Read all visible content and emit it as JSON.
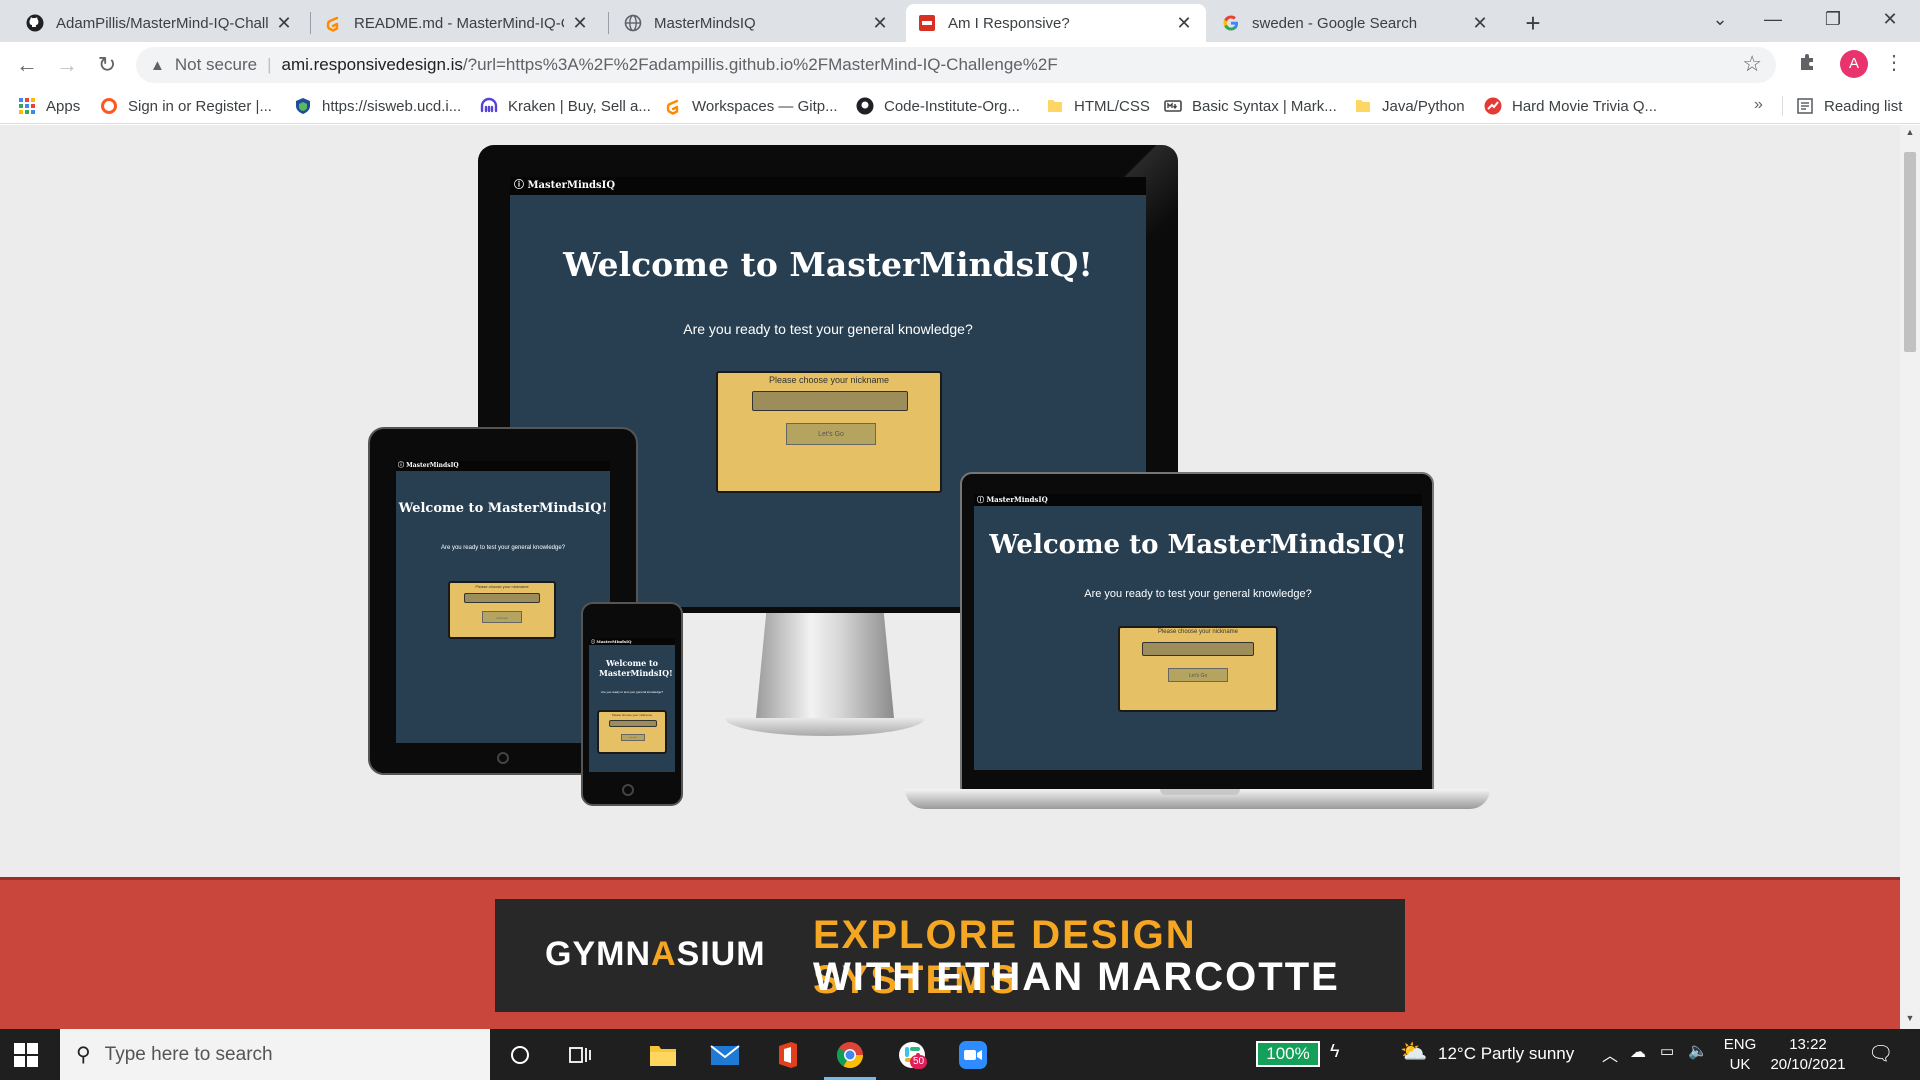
{
  "browser": {
    "tabs": [
      {
        "title": "AdamPillis/MasterMind-IQ-Challenge",
        "favicon": "github-icon",
        "active": false
      },
      {
        "title": "README.md - MasterMind-IQ-Challenge",
        "favicon": "gitpod-icon",
        "active": false
      },
      {
        "title": "MasterMindsIQ",
        "favicon": "globe-icon",
        "active": false
      },
      {
        "title": "Am I Responsive?",
        "favicon": "ami-icon",
        "active": true
      },
      {
        "title": "sweden - Google Search",
        "favicon": "google-icon",
        "active": false
      }
    ],
    "address": {
      "security_label": "Not secure",
      "host": "ami.responsivedesign.is",
      "path": "/?url=https%3A%2F%2Fadampillis.github.io%2FMasterMind-IQ-Challenge%2F"
    },
    "profile_initial": "A",
    "bookmarks": [
      {
        "label": "Apps",
        "icon": "apps-grid-icon"
      },
      {
        "label": "Sign in or Register |...",
        "icon": "ring-icon"
      },
      {
        "label": "https://sisweb.ucd.i...",
        "icon": "shield-icon"
      },
      {
        "label": "Kraken | Buy, Sell a...",
        "icon": "kraken-icon"
      },
      {
        "label": "Workspaces — Gitp...",
        "icon": "gitpod-icon"
      },
      {
        "label": "Code-Institute-Org...",
        "icon": "github-icon"
      },
      {
        "label": "HTML/CSS",
        "icon": "folder-icon"
      },
      {
        "label": "Basic Syntax | Mark...",
        "icon": "markdown-icon"
      },
      {
        "label": "Java/Python",
        "icon": "folder-icon"
      },
      {
        "label": "Hard Movie Trivia Q...",
        "icon": "trivia-icon"
      }
    ],
    "more_bookmarks": "»",
    "reading_list": "Reading list"
  },
  "site": {
    "brand": "MasterMindsIQ",
    "welcome": "Welcome to MasterMindsIQ!",
    "prompt": "Are you ready to test your general knowledge?",
    "nickname_label": "Please choose your nickname",
    "go_button": "Let's Go"
  },
  "ad": {
    "brand_prefix": "GYMN",
    "brand_accent": "A",
    "brand_suffix": "SIUM",
    "line1": "EXPLORE DESIGN SYSTEMS",
    "line2": "WITH ETHAN MARCOTTE"
  },
  "taskbar": {
    "search_placeholder": "Type here to search",
    "battery": "100%",
    "weather": "12°C  Partly sunny",
    "lang_top": "ENG",
    "lang_bottom": "UK",
    "time": "13:22",
    "date": "20/10/2021",
    "mail_badge": "50"
  },
  "colors": {
    "site_bg": "#283f52",
    "card": "#e6c065",
    "ad_strip": "#c9463d",
    "ad_accent": "#f5a623",
    "active_tab_icon": "#d93025"
  }
}
